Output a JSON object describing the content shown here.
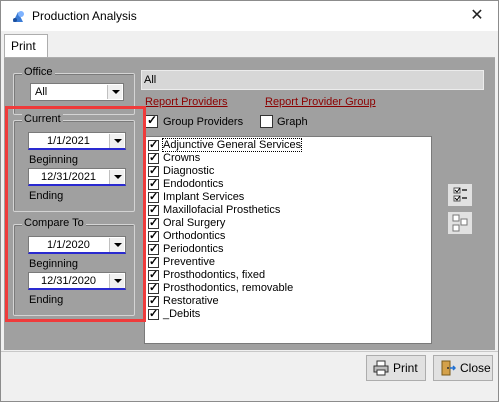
{
  "window": {
    "title": "Production Analysis",
    "close_glyph": "✕"
  },
  "tabs": [
    {
      "label": "Print"
    }
  ],
  "office": {
    "label": "Office",
    "value": "All"
  },
  "current": {
    "label": "Current",
    "start": "1/1/2021",
    "start_caption": "Beginning",
    "end": "12/31/2021",
    "end_caption": "Ending"
  },
  "compare": {
    "label": "Compare To",
    "start": "1/1/2020",
    "start_caption": "Beginning",
    "end": "12/31/2020",
    "end_caption": "Ending"
  },
  "providers": {
    "selection_text": "All",
    "link_report_providers": "Report Providers",
    "link_report_provider_group": "Report Provider Group",
    "group_providers_label": "Group Providers",
    "group_providers_checked": true,
    "graph_label": "Graph",
    "graph_checked": false
  },
  "services": [
    {
      "label": "Adjunctive General Services",
      "checked": true
    },
    {
      "label": "Crowns",
      "checked": true
    },
    {
      "label": "Diagnostic",
      "checked": true
    },
    {
      "label": "Endodontics",
      "checked": true
    },
    {
      "label": "Implant Services",
      "checked": true
    },
    {
      "label": "Maxillofacial Prosthetics",
      "checked": true
    },
    {
      "label": "Oral Surgery",
      "checked": true
    },
    {
      "label": "Orthodontics",
      "checked": true
    },
    {
      "label": "Periodontics",
      "checked": true
    },
    {
      "label": "Preventive",
      "checked": true
    },
    {
      "label": "Prosthodontics, fixed",
      "checked": true
    },
    {
      "label": "Prosthodontics, removable",
      "checked": true
    },
    {
      "label": "Restorative",
      "checked": true
    },
    {
      "label": "_Debits",
      "checked": true
    }
  ],
  "side_buttons": [
    {
      "icon": "check-all-icon"
    },
    {
      "icon": "uncheck-all-icon"
    }
  ],
  "buttons": {
    "print": "Print",
    "close": "Close"
  },
  "colors": {
    "highlight": "#ef3b3b",
    "link": "#8b0000",
    "content_bg": "#a0a0a0",
    "date_underline": "#2a2ad0"
  }
}
